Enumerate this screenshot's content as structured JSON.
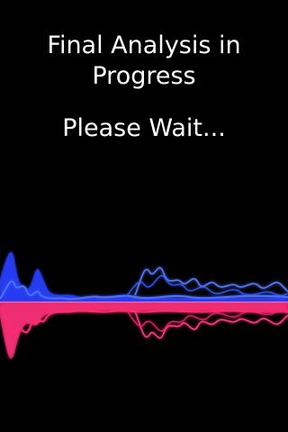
{
  "screen": {
    "title": "Final Analysis in\nProgress",
    "status": "Please Wait..."
  },
  "waveform": {
    "name": "audio-waveform-visualization",
    "colors": {
      "upper": "#3a5cff",
      "upper_glow": "#2a40ff",
      "lower": "#ff1f6a",
      "lower_glow": "#ff2f7a",
      "background": "#000000"
    }
  }
}
